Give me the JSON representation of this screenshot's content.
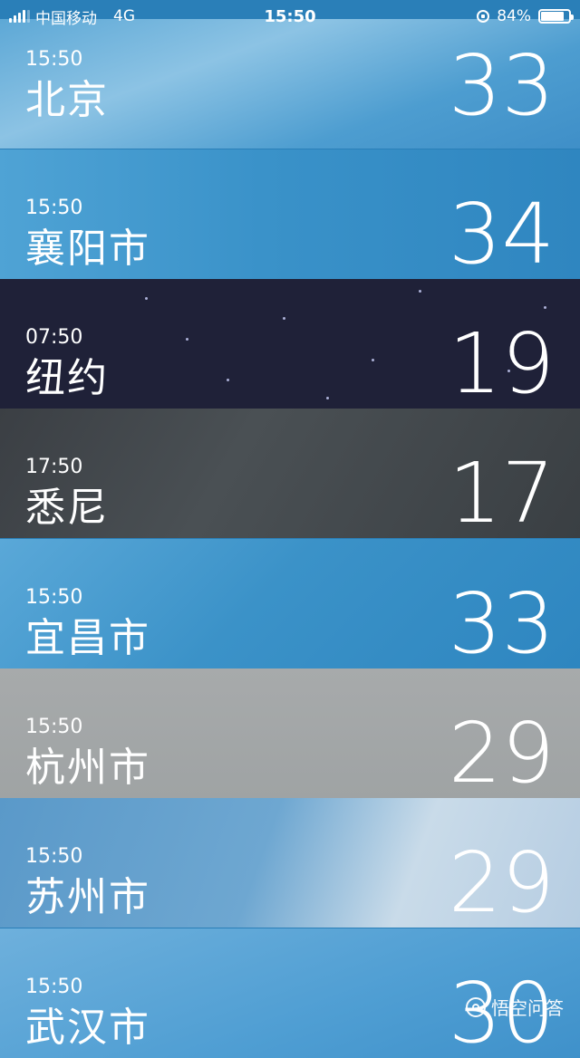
{
  "status_bar": {
    "carrier": "中国移动",
    "network": "4G",
    "time": "15:50",
    "battery_text": "84%",
    "battery_level": 0.84
  },
  "cities": [
    {
      "time": "15:50",
      "name": "北京",
      "temp": "33"
    },
    {
      "time": "15:50",
      "name": "襄阳市",
      "temp": "34"
    },
    {
      "time": "07:50",
      "name": "纽约",
      "temp": "19"
    },
    {
      "time": "17:50",
      "name": "悉尼",
      "temp": "17"
    },
    {
      "time": "15:50",
      "name": "宜昌市",
      "temp": "33"
    },
    {
      "time": "15:50",
      "name": "杭州市",
      "temp": "29"
    },
    {
      "time": "15:50",
      "name": "苏州市",
      "temp": "29"
    },
    {
      "time": "15:50",
      "name": "武汉市",
      "temp": "30"
    }
  ],
  "watermark": {
    "text": "悟空问答"
  },
  "colors": {
    "night": "#1f2138",
    "cloudy": "#3b3f44",
    "overcast": "#a7aaab",
    "sky": "#3a92c9"
  }
}
